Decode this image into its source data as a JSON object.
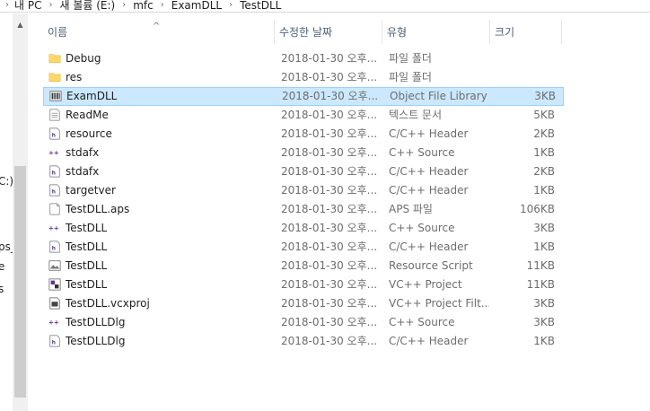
{
  "breadcrumb": {
    "items": [
      "내 PC",
      "새 볼륨 (E:)",
      "mfc",
      "ExamDLL",
      "TestDLL"
    ]
  },
  "nav": {
    "fragments": [
      "C:)",
      "ps_|",
      "e",
      "s"
    ]
  },
  "columns": {
    "name": "이름",
    "date": "수정한 날짜",
    "type": "유형",
    "size": "크기"
  },
  "files": [
    {
      "name": "Debug",
      "date": "2018-01-30 오후...",
      "type": "파일 폴더",
      "size": "",
      "icon": "folder-icon"
    },
    {
      "name": "res",
      "date": "2018-01-30 오후...",
      "type": "파일 폴더",
      "size": "",
      "icon": "folder-icon"
    },
    {
      "name": "ExamDLL",
      "date": "2018-01-30 오후...",
      "type": "Object File Library",
      "size": "3KB",
      "icon": "library-icon",
      "selected": true
    },
    {
      "name": "ReadMe",
      "date": "2018-01-30 오후...",
      "type": "텍스트 문서",
      "size": "5KB",
      "icon": "text-file-icon"
    },
    {
      "name": "resource",
      "date": "2018-01-30 오후...",
      "type": "C/C++ Header",
      "size": "2KB",
      "icon": "header-file-icon"
    },
    {
      "name": "stdafx",
      "date": "2018-01-30 오후...",
      "type": "C++ Source",
      "size": "1KB",
      "icon": "cpp-source-icon"
    },
    {
      "name": "stdafx",
      "date": "2018-01-30 오후...",
      "type": "C/C++ Header",
      "size": "2KB",
      "icon": "header-file-icon"
    },
    {
      "name": "targetver",
      "date": "2018-01-30 오후...",
      "type": "C/C++ Header",
      "size": "1KB",
      "icon": "header-file-icon"
    },
    {
      "name": "TestDLL.aps",
      "date": "2018-01-30 오후...",
      "type": "APS 파일",
      "size": "106KB",
      "icon": "blank-file-icon"
    },
    {
      "name": "TestDLL",
      "date": "2018-01-30 오후...",
      "type": "C++ Source",
      "size": "3KB",
      "icon": "cpp-source-icon"
    },
    {
      "name": "TestDLL",
      "date": "2018-01-30 오후...",
      "type": "C/C++ Header",
      "size": "1KB",
      "icon": "header-file-icon"
    },
    {
      "name": "TestDLL",
      "date": "2018-01-30 오후...",
      "type": "Resource Script",
      "size": "11KB",
      "icon": "resource-script-icon"
    },
    {
      "name": "TestDLL",
      "date": "2018-01-30 오후...",
      "type": "VC++ Project",
      "size": "11KB",
      "icon": "vc-project-icon"
    },
    {
      "name": "TestDLL.vcxproj",
      "date": "2018-01-30 오후...",
      "type": "VC++ Project Filt...",
      "size": "3KB",
      "icon": "vc-filters-icon"
    },
    {
      "name": "TestDLLDlg",
      "date": "2018-01-30 오후...",
      "type": "C++ Source",
      "size": "3KB",
      "icon": "cpp-source-icon"
    },
    {
      "name": "TestDLLDlg",
      "date": "2018-01-30 오후...",
      "type": "C/C++ Header",
      "size": "1KB",
      "icon": "header-file-icon"
    }
  ],
  "colors": {
    "selection_bg": "#cce8ff",
    "selection_border": "#99d1ff",
    "folder": "#ffd766",
    "header_text": "#4c607a"
  }
}
